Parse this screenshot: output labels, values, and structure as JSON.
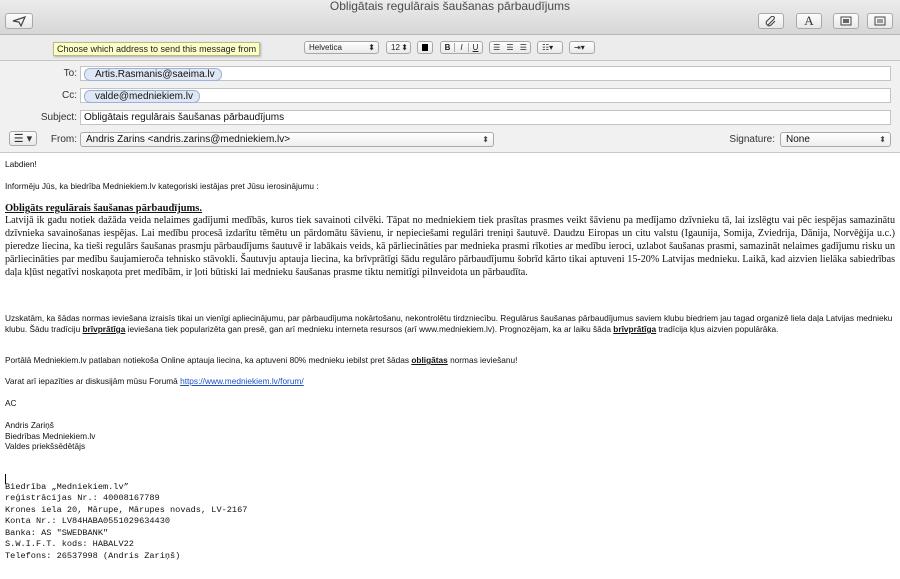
{
  "window": {
    "title": "Obligātais regulārais šaušanas pārbaudījums"
  },
  "toolbar": {
    "send_icon": "send-icon",
    "attach_icon": "paperclip-icon",
    "fonts_label": "A",
    "photo_icon": "photo-icon",
    "template_icon": "template-icon"
  },
  "tooltip": "Choose which address to send this message from",
  "format": {
    "font": "Helvetica",
    "size": "12",
    "bold": "B",
    "italic": "I",
    "underline": "U"
  },
  "header": {
    "to_label": "To:",
    "to_value": "Artis.Rasmanis@saeima.lv",
    "cc_label": "Cc:",
    "cc_value": "valde@medniekiem.lv",
    "subject_label": "Subject:",
    "subject_value": "Obligātais regulārais šaušanas pārbaudījums",
    "from_label": "From:",
    "from_value": "Andris Zarins <andris.zarins@medniekiem.lv>",
    "signature_label": "Signature:",
    "signature_value": "None"
  },
  "body": {
    "greeting": "Labdien!",
    "intro": "Informēju Jūs, ka biedrība Medniekiem.lv kategoriski iestājas pret Jūsu ierosinājumu :",
    "heading": "Obligāts regulārais šaušanas pārbaudījums.",
    "serif_paragraph": "Latvijā ik gadu notiek dažāda veida nelaimes gadījumi medībās, kuros tiek savainoti cilvēki. Tāpat no medniekiem tiek prasītas prasmes veikt šāvienu pa medījamo dzīvnieku tā, lai izslēgtu vai pēc iespējas samazinātu dzīvnieka savainošanas iespējas. Lai medību procesā izdarītu tēmētu un pārdomātu šāvienu, ir nepieciešami regulāri treniņi šautuvē. Daudzu Eiropas un citu valstu (Igaunija, Somija, Zviedrija, Dānija, Norvēģija u.c.) pieredze liecina, ka tieši regulārs šaušanas prasmju pārbaudījums šautuvē ir labākais veids, kā pārliecināties par mednieka prasmi rīkoties ar medību ieroci, uzlabot šaušanas prasmi, samazināt nelaimes gadījumu risku un pārliecināties par medību šaujamieroča tehnisko stāvokli. Šautuvju aptauja liecina, ka brīvprātīgi šādu regulāro pārbaudījumu šobrīd kārto tikai aptuveni 15-20% Latvijas mednieku. Laikā, kad aizvien lielāka sabiedrības daļa kļūst negatīvi noskaņota pret medībām, ir ļoti būtiski lai mednieku šaušanas prasme tiktu nemitīgi pilnveidota un pārbaudīta.",
    "para2_a": "Uzskatām, ka šādas normas ieviešana izraisīs tikai un vienīgi apliecinājumu, par pārbaudījuma nokārtošanu, nekontrolētu tirdzniecību. Regulārus šaušanas pārbaudījumus saviem klubu biedriem jau tagad organizē liela daļa Latvijas mednieku klubu. Šādu tradīciju ",
    "para2_b": "brīvprātīga",
    "para2_c": " ieviešana tiek popularizēta gan presē, gan arī mednieku interneta resursos (arī www.medniekiem.lv).  Prognozējam, ka ar laiku šāda ",
    "para2_d": "brīvprātīga",
    "para2_e": " tradīcija kļus aizvien populārāka.",
    "para3_a": "Portālā Medniekiem.lv  patlaban notiekoša Online aptauja liecina, ka aptuveni 80% mednieku iebilst pret šādas ",
    "para3_b": "obligātas",
    "para3_c": " normas ieviešanu!",
    "forum_text": "Varat arī iepazīties ar diskusijām mūsu Forumā ",
    "forum_link": "https://www.medniekiem.lv/forum/",
    "closing": "AC",
    "sign_name": "Andris Zariņš",
    "sign_org": "Biedrības Medniekiem.lv",
    "sign_role": "Valdes priekšsēdētājs",
    "footer": [
      "Biedrība „Medniekiem.lv”",
      "reģistrācijas Nr.: 40008167789",
      "Krones iela 20, Mārupe, Mārupes novads, LV-2167",
      "Konta Nr.: LV84HABA0551029634430",
      "Banka: AS \"SWEDBANK\"",
      "S.W.I.F.T. kods: HABALV22",
      "Telefons: 26537998 (Andris Zariņš)"
    ]
  }
}
